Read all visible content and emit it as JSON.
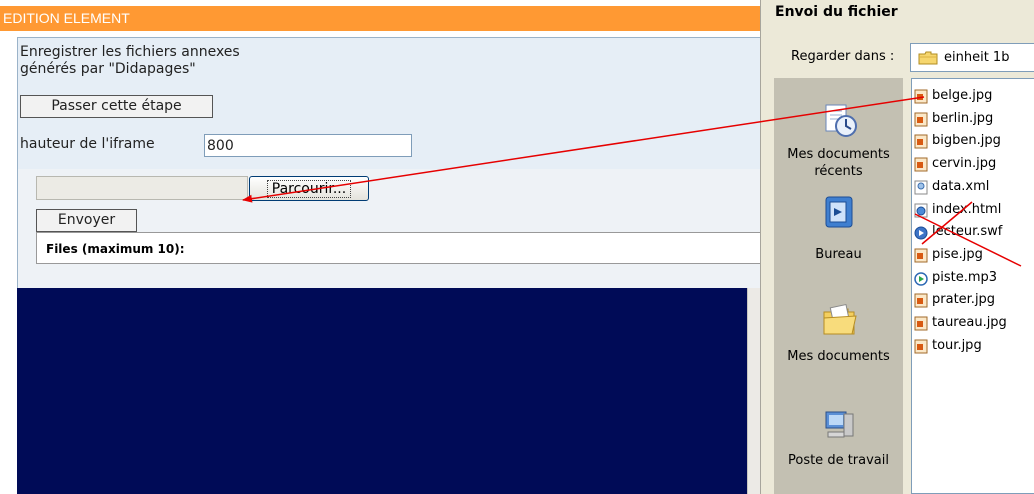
{
  "edition": {
    "header_title": "EDITION ELEMENT",
    "description": "Enregistrer les fichiers annexes\ngénérés par \"Didapages\"",
    "skip_button": "Passer cette étape",
    "iframe_label": "hauteur de l'iframe",
    "iframe_height": "800",
    "browse_button": "Parcourir...",
    "send_button": "Envoyer",
    "files_label": "Files (maximum 10):"
  },
  "dialog": {
    "title": "Envoi du fichier",
    "look_in_label": "Regarder dans :",
    "look_in_value": "einheit 1b",
    "places": [
      {
        "label": "Mes documents\nrécents",
        "icon": "recent-documents-icon"
      },
      {
        "label": "Bureau",
        "icon": "desktop-icon"
      },
      {
        "label": "Mes documents",
        "icon": "my-documents-icon"
      },
      {
        "label": "Poste de travail",
        "icon": "my-computer-icon"
      }
    ],
    "files": [
      {
        "name": "belge.jpg",
        "icon": "jpg-file-icon"
      },
      {
        "name": "berlin.jpg",
        "icon": "jpg-file-icon"
      },
      {
        "name": "bigben.jpg",
        "icon": "jpg-file-icon"
      },
      {
        "name": "cervin.jpg",
        "icon": "jpg-file-icon"
      },
      {
        "name": "data.xml",
        "icon": "xml-file-icon"
      },
      {
        "name": "index.html",
        "icon": "html-file-icon"
      },
      {
        "name": "lecteur.swf",
        "icon": "swf-file-icon"
      },
      {
        "name": "pise.jpg",
        "icon": "jpg-file-icon"
      },
      {
        "name": "piste.mp3",
        "icon": "mp3-file-icon"
      },
      {
        "name": "prater.jpg",
        "icon": "jpg-file-icon"
      },
      {
        "name": "taureau.jpg",
        "icon": "jpg-file-icon"
      },
      {
        "name": "tour.jpg",
        "icon": "jpg-file-icon"
      }
    ]
  },
  "colors": {
    "header": "#ff9933",
    "panel": "#e6eef6",
    "preview": "#000b57",
    "annotation": "#e60000"
  }
}
